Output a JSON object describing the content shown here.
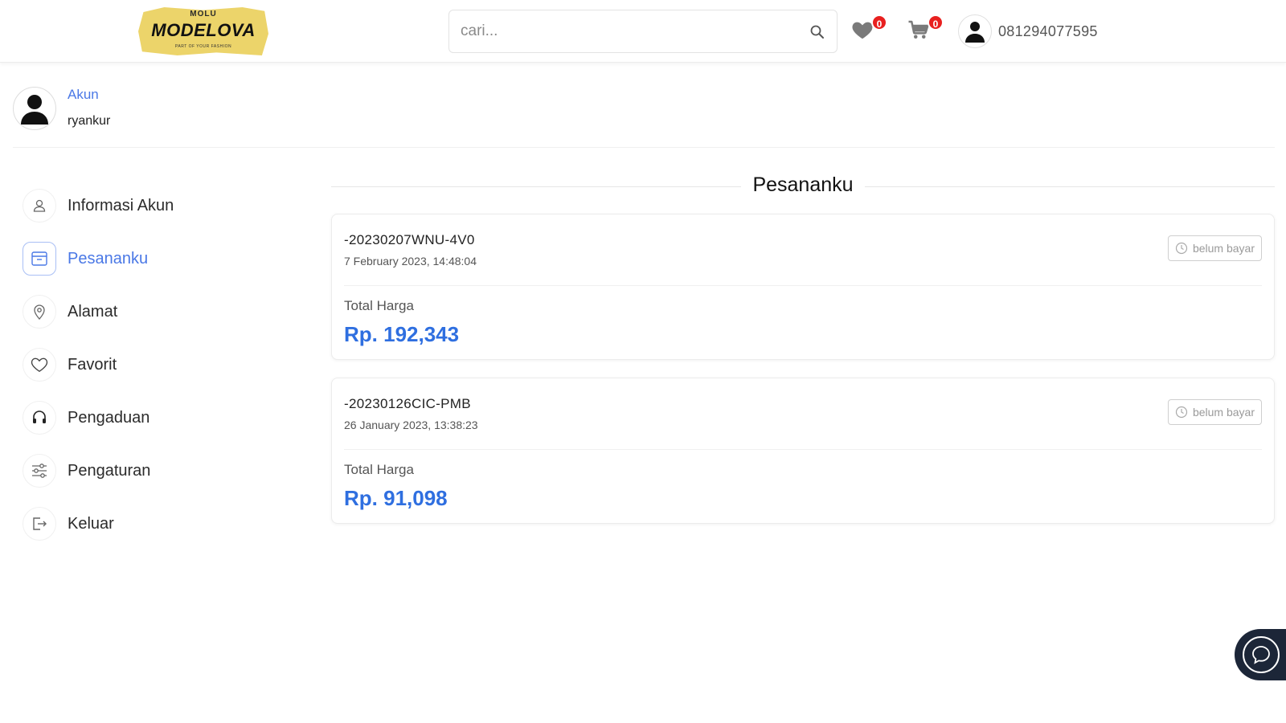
{
  "brand": {
    "logo_top": "MOLU",
    "logo_main": "MODELOVA",
    "logo_sub": "PART OF YOUR FASHION"
  },
  "header": {
    "search_placeholder": "cari...",
    "favorites_count": "0",
    "cart_count": "0",
    "phone": "081294077595"
  },
  "account": {
    "label": "Akun",
    "username": "ryankur"
  },
  "sidebar": {
    "items": [
      {
        "label": "Informasi Akun",
        "icon": "user-icon",
        "active": false
      },
      {
        "label": "Pesananku",
        "icon": "box-icon",
        "active": true
      },
      {
        "label": "Alamat",
        "icon": "location-pin-icon",
        "active": false
      },
      {
        "label": "Favorit",
        "icon": "heart-icon",
        "active": false
      },
      {
        "label": "Pengaduan",
        "icon": "headset-icon",
        "active": false
      },
      {
        "label": "Pengaturan",
        "icon": "sliders-icon",
        "active": false
      },
      {
        "label": "Keluar",
        "icon": "logout-icon",
        "active": false
      }
    ]
  },
  "orders": {
    "title": "Pesananku",
    "items": [
      {
        "id": "-20230207WNU-4V0",
        "date": "7 February 2023, 14:48:04",
        "status": "belum bayar",
        "total_label": "Total Harga",
        "total": "Rp. 192,343"
      },
      {
        "id": "-20230126CIC-PMB",
        "date": "26 January 2023, 13:38:23",
        "status": "belum bayar",
        "total_label": "Total Harga",
        "total": "Rp. 91,098"
      }
    ]
  },
  "colors": {
    "accent": "#4a78e6",
    "price": "#2f6fe0",
    "badge": "#e8201f",
    "logo": "#ecd46a",
    "chat_fab": "#1c2638"
  }
}
